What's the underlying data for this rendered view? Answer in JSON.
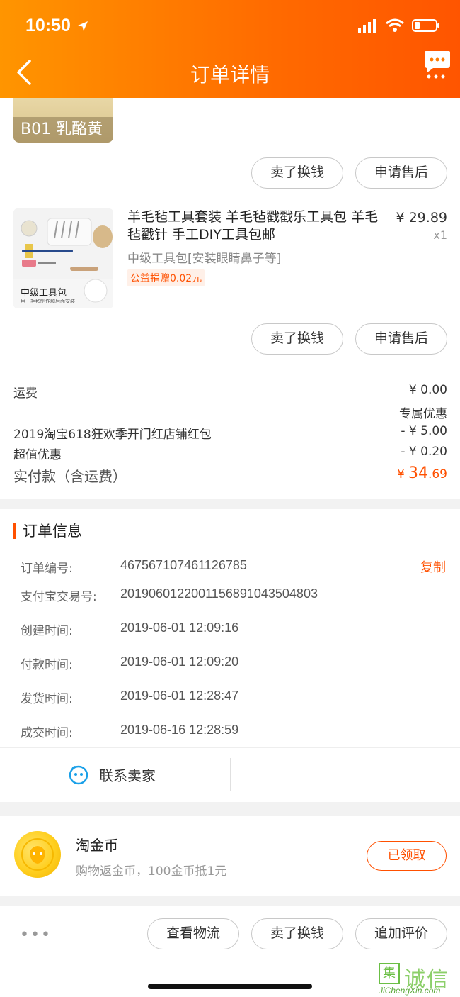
{
  "status_bar": {
    "time": "10:50"
  },
  "nav": {
    "title": "订单详情"
  },
  "prev_item": {
    "sku_label": "B01 乳酪黄"
  },
  "prev_item_actions": {
    "sell": "卖了换钱",
    "after_sale": "申请售后"
  },
  "product": {
    "title": "羊毛毡工具套装 羊毛毡戳戳乐工具包 羊毛毡戳针 手工DIY工具包邮",
    "price": "¥ 29.89",
    "quantity": "x1",
    "sku": "中级工具包[安装眼睛鼻子等]",
    "charity_tag": "公益捐赠0.02元",
    "thumb_caption": "中级工具包",
    "thumb_subcaption": "用于毛毡制作和后面安装",
    "sell_button": "卖了换钱",
    "after_sale_button": "申请售后"
  },
  "fees": {
    "shipping_label": "运费",
    "shipping_value": "¥ 0.00",
    "exclusive_label": "专属优惠",
    "coupon_label": "2019淘宝618狂欢季开门红店铺红包",
    "coupon_value": "- ¥ 5.00",
    "discount_label": "超值优惠",
    "discount_value": "- ¥ 0.20",
    "total_label": "实付款（含运费）",
    "total_currency": "¥",
    "total_int": "34",
    "total_dec": ".69"
  },
  "order_info": {
    "title": "订单信息",
    "copy_label": "复制",
    "rows": [
      {
        "label": "订单编号:",
        "value": "467567107461126785"
      },
      {
        "label": "支付宝交易号:",
        "value": "2019060122001156891043504803"
      },
      {
        "label": "创建时间:",
        "value": "2019-06-01 12:09:16"
      },
      {
        "label": "付款时间:",
        "value": "2019-06-01 12:09:20"
      },
      {
        "label": "发货时间:",
        "value": "2019-06-01 12:28:47"
      },
      {
        "label": "成交时间:",
        "value": "2019-06-16 12:28:59"
      }
    ]
  },
  "contact": {
    "label": "联系卖家"
  },
  "coins": {
    "title": "淘金币",
    "subtitle": "购物返金币，100金币抵1元",
    "button": "已领取"
  },
  "bottom_bar": {
    "more": "•••",
    "logistics": "查看物流",
    "sell": "卖了换钱",
    "review": "追加评价"
  },
  "watermark": {
    "cn": "诚信",
    "box": "集",
    "en": "JiChengXin.com"
  },
  "colors": {
    "accent": "#ff5000",
    "header_start": "#ff9500",
    "header_end": "#ff5500"
  }
}
